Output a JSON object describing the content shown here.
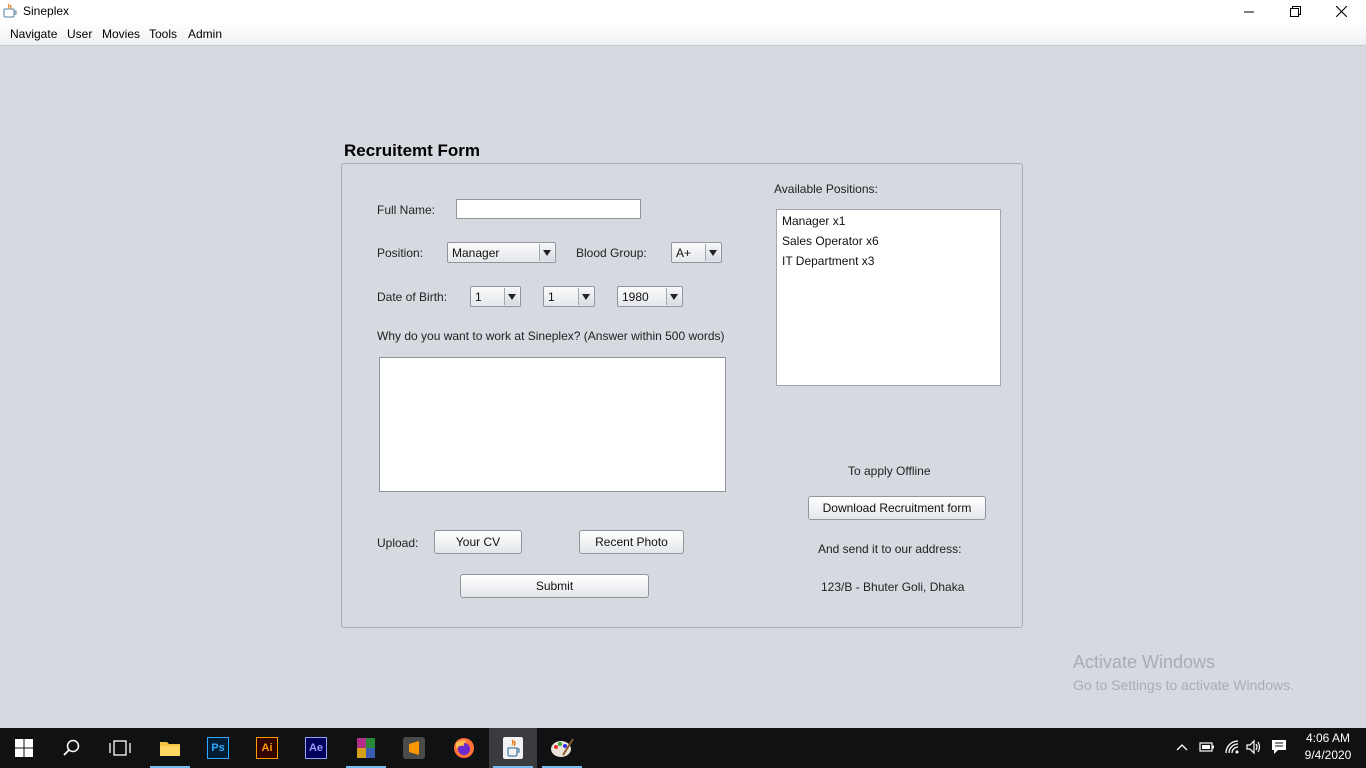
{
  "window": {
    "title": "Sineplex"
  },
  "menu": [
    "Navigate",
    "User",
    "Movies",
    "Tools",
    "Admin"
  ],
  "form": {
    "title": "Recruitemt Form",
    "full_name_label": "Full Name:",
    "full_name_value": "",
    "position_label": "Position:",
    "position_value": "Manager",
    "blood_group_label": "Blood Group:",
    "blood_group_value": "A+",
    "dob_label": "Date of Birth:",
    "dob_day": "1",
    "dob_month": "1",
    "dob_year": "1980",
    "question": "Why do you want to work at Sineplex? (Answer within 500 words)",
    "answer_value": "",
    "upload_label": "Upload:",
    "cv_button": "Your CV",
    "photo_button": "Recent Photo",
    "submit_button": "Submit"
  },
  "positions": {
    "label": "Available Positions:",
    "items": [
      "Manager x1",
      "Sales Operator x6",
      "IT Department x3"
    ]
  },
  "offline": {
    "heading": "To apply Offline",
    "download_button": "Download Recruitment form",
    "send_text": "And send it to our address:",
    "address": "123/B - Bhuter Goli, Dhaka"
  },
  "watermark": {
    "title": "Activate Windows",
    "subtitle": "Go to Settings to activate Windows."
  },
  "taskbar": {
    "apps": [
      "start-icon",
      "search-icon",
      "task-view-icon",
      "file-explorer-icon",
      "photoshop-icon",
      "illustrator-icon",
      "after-effects-icon",
      "winrar-icon",
      "sublime-text-icon",
      "firefox-icon",
      "java-icon",
      "paint-icon"
    ],
    "ps_label": "Ps",
    "ai_label": "Ai",
    "ae_label": "Ae",
    "time": "4:06 AM",
    "date": "9/4/2020"
  },
  "colors": {
    "background": "#d6d9df",
    "taskbar": "#101113",
    "taskbar_accent": "#76b9ed"
  }
}
